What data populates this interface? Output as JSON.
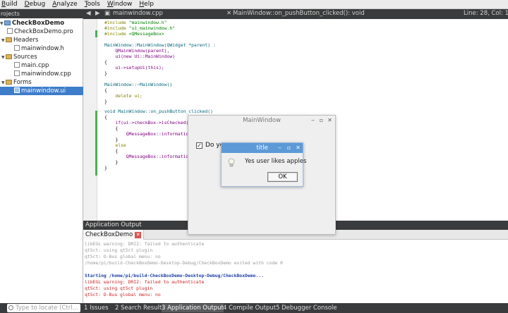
{
  "menu": {
    "items": [
      {
        "label": "Build",
        "ul": "B",
        "rest": "uild"
      },
      {
        "label": "Debug",
        "ul": "D",
        "rest": "ebug"
      },
      {
        "label": "Analyze",
        "ul": "A",
        "rest": "nalyze"
      },
      {
        "label": "Tools",
        "ul": "T",
        "rest": "ools"
      },
      {
        "label": "Window",
        "ul": "W",
        "rest": "indow"
      },
      {
        "label": "Help",
        "ul": "H",
        "rest": "elp"
      }
    ]
  },
  "projects": {
    "header": "rojects",
    "root": "CheckBoxDemo",
    "pro_file": "CheckBoxDemo.pro",
    "headers_label": "Headers",
    "header_file": "mainwindow.h",
    "sources_label": "Sources",
    "source_main": "main.cpp",
    "source_mainwindow": "mainwindow.cpp",
    "forms_label": "Forms",
    "form_file": "mainwindow.ui"
  },
  "editor": {
    "file_tab": "mainwindow.cpp",
    "function_tab": "MainWindow::on_pushButton_clicked(): void",
    "position": "Line: 28, Col: 1",
    "code": {
      "l1a": "#include ",
      "l1b": "\"mainwindow.h\"",
      "l2a": "#include ",
      "l2b": "\"ui_mainwindow.h\"",
      "l3a": "#include ",
      "l3b": "<QMessageBox>",
      "l5": "MainWindow::MainWindow(QWidget *parent) :",
      "l6": "    QMainWindow(parent),",
      "l7": "    ui(new Ui::MainWindow)",
      "l8": "{",
      "l9": "    ui->setupUi(this);",
      "l10": "}",
      "l12": "MainWindow::~MainWindow()",
      "l13": "{",
      "l14": "    delete ui;",
      "l15": "}",
      "l17": "void MainWindow::on_pushButton_clicked()",
      "l18": "{",
      "l19": "    if(ui->checkBox->isChecked()",
      "l20": "    {",
      "l21": "        QMessageBox::information",
      "l22": "    }",
      "l23": "    else",
      "l24": "    {",
      "l25": "        QMessageBox::information",
      "l26": "    }",
      "l27": "}"
    }
  },
  "output": {
    "header": "Application Output",
    "tab": "CheckBoxDemo",
    "lines": [
      "libEGL warning: DRI2: failed to authenticate",
      "qt5ct: using qt5ct plugin",
      "qt5ct: D-Bus global menu: no",
      "/home/pi/build-CheckBoxDemo-Desktop-Debug/CheckBoxDemo exited with code 0",
      "",
      "Starting /home/pi/build-CheckBoxDemo-Desktop-Debug/CheckBoxDemo...",
      "libEGL warning: DRI2: failed to authenticate",
      "qt5ct: using qt5ct plugin",
      "qt5ct: D-Bus global menu: no"
    ]
  },
  "statusbar": {
    "locate_placeholder": "Type to locate (Ctrl...",
    "tabs": [
      "1 Issues",
      "2 Search Results",
      "3 Application Output",
      "4 Compile Output",
      "5 Debugger Console"
    ]
  },
  "mainwindow": {
    "title": "MainWindow",
    "checkbox_label": "Do yo"
  },
  "messagebox": {
    "title": "title",
    "text": "Yes user likes apples",
    "ok": "OK"
  },
  "colors": {
    "selection": "#3d7dca",
    "dialog_title": "#5c99d6",
    "dark_panel": "#3a3b3c"
  }
}
